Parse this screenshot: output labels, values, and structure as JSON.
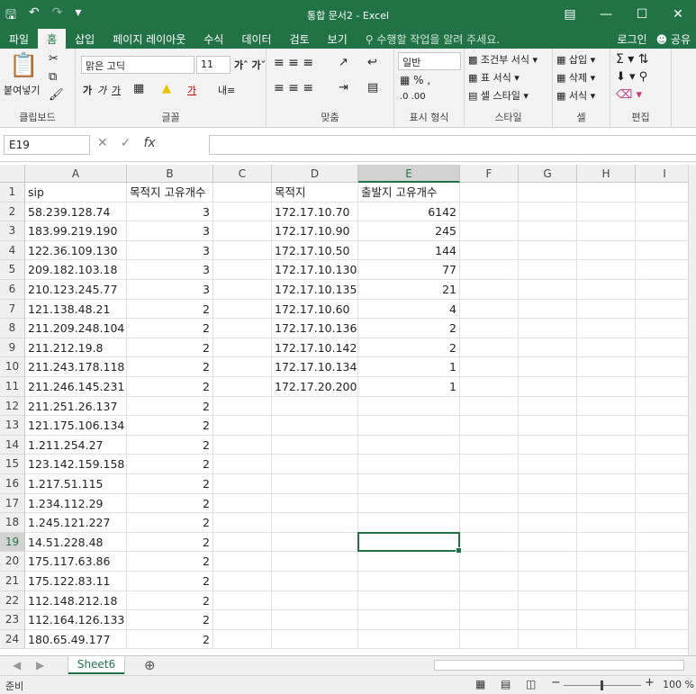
{
  "window": {
    "title": "통합 문서2 - Excel",
    "qat": [
      "save-icon",
      "undo-icon",
      "redo-icon",
      "customize-icon"
    ]
  },
  "tabs": [
    "파일",
    "홈",
    "삽입",
    "페이지 레이아웃",
    "수식",
    "데이터",
    "검토",
    "보기"
  ],
  "tell_me": "수행할 작업을 알려 주세요.",
  "account": {
    "login": "로그인",
    "share": "공유"
  },
  "ribbon": {
    "clipboard": {
      "label": "클립보드",
      "paste": "붙여넣기"
    },
    "font": {
      "label": "글꼴",
      "name": "맑은 고딕",
      "size": "11"
    },
    "alignment": {
      "label": "맞춤"
    },
    "number": {
      "label": "표시 형식",
      "format": "일반"
    },
    "styles": {
      "label": "스타일",
      "cond": "조건부 서식",
      "table": "표 서식",
      "cell": "셀 스타일"
    },
    "cells": {
      "label": "셀",
      "insert": "삽입",
      "delete": "삭제",
      "format": "서식"
    },
    "editing": {
      "label": "편집"
    }
  },
  "formula_bar": {
    "name_box": "E19",
    "fx": "fx",
    "value": ""
  },
  "columns": [
    "A",
    "B",
    "C",
    "D",
    "E",
    "F",
    "G",
    "H",
    "I"
  ],
  "selected": {
    "column": "E",
    "row": 19,
    "cell": "E19"
  },
  "rows": [
    [
      "sip",
      "목적지 고유개수",
      "",
      "목적지",
      "출발지 고유개수"
    ],
    [
      "58.239.128.74",
      "3",
      "",
      "172.17.10.70",
      "6142"
    ],
    [
      "183.99.219.190",
      "3",
      "",
      "172.17.10.90",
      "245"
    ],
    [
      "122.36.109.130",
      "3",
      "",
      "172.17.10.50",
      "144"
    ],
    [
      "209.182.103.18",
      "3",
      "",
      "172.17.10.130",
      "77"
    ],
    [
      "210.123.245.77",
      "3",
      "",
      "172.17.10.135",
      "21"
    ],
    [
      "121.138.48.21",
      "2",
      "",
      "172.17.10.60",
      "4"
    ],
    [
      "211.209.248.104",
      "2",
      "",
      "172.17.10.136",
      "2"
    ],
    [
      "211.212.19.8",
      "2",
      "",
      "172.17.10.142",
      "2"
    ],
    [
      "211.243.178.118",
      "2",
      "",
      "172.17.10.134",
      "1"
    ],
    [
      "211.246.145.231",
      "2",
      "",
      "172.17.20.200",
      "1"
    ],
    [
      "211.251.26.137",
      "2",
      "",
      "",
      ""
    ],
    [
      "121.175.106.134",
      "2",
      "",
      "",
      ""
    ],
    [
      "1.211.254.27",
      "2",
      "",
      "",
      ""
    ],
    [
      "123.142.159.158",
      "2",
      "",
      "",
      ""
    ],
    [
      "1.217.51.115",
      "2",
      "",
      "",
      ""
    ],
    [
      "1.234.112.29",
      "2",
      "",
      "",
      ""
    ],
    [
      "1.245.121.227",
      "2",
      "",
      "",
      ""
    ],
    [
      "14.51.228.48",
      "2",
      "",
      "",
      ""
    ],
    [
      "175.117.63.86",
      "2",
      "",
      "",
      ""
    ],
    [
      "175.122.83.11",
      "2",
      "",
      "",
      ""
    ],
    [
      "112.148.212.18",
      "2",
      "",
      "",
      ""
    ],
    [
      "112.164.126.133",
      "2",
      "",
      "",
      ""
    ],
    [
      "180.65.49.177",
      "2",
      "",
      "",
      ""
    ]
  ],
  "sheet": {
    "name": "Sheet6",
    "add": "⊕"
  },
  "status": {
    "ready": "준비",
    "zoom": "100 %"
  },
  "colors": {
    "accent": "#217346"
  }
}
